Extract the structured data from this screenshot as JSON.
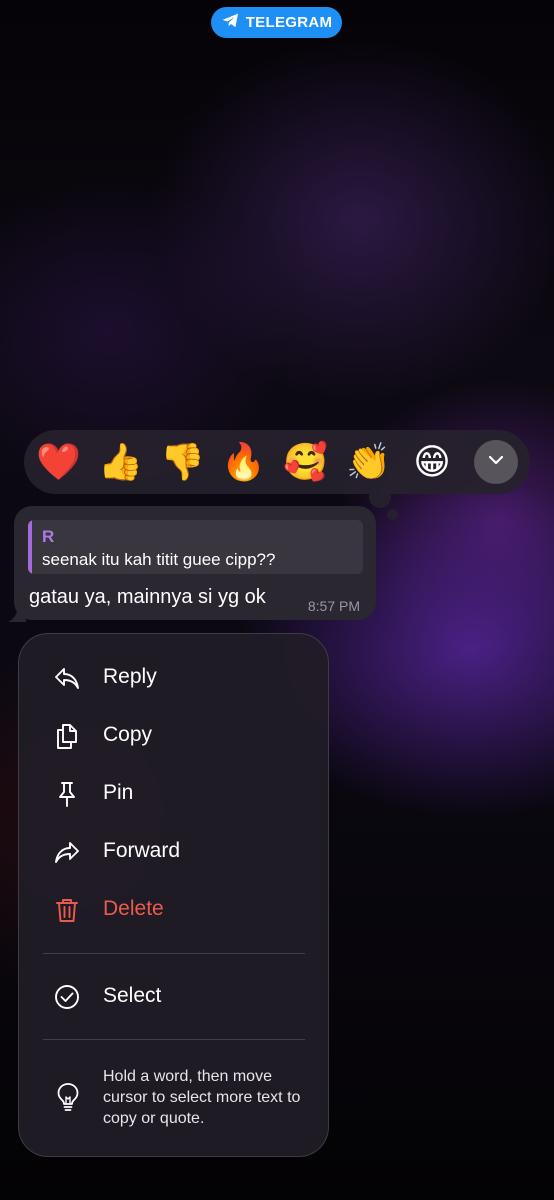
{
  "source_badge": {
    "label": "TELEGRAM",
    "color": "#1e8ff5"
  },
  "reactions": {
    "items": [
      {
        "name": "red-heart",
        "glyph": "❤️"
      },
      {
        "name": "thumbs-up",
        "glyph": "👍"
      },
      {
        "name": "thumbs-down",
        "glyph": "👎"
      },
      {
        "name": "fire",
        "glyph": "🔥"
      },
      {
        "name": "smiling-face-with-hearts",
        "glyph": "🥰"
      },
      {
        "name": "clapping-hands",
        "glyph": "👏"
      },
      {
        "name": "beaming-face",
        "glyph": "😁"
      }
    ],
    "expand_icon": "chevron-down-icon"
  },
  "message": {
    "reply": {
      "author": "R",
      "text": "seenak itu kah titit guee cipp??",
      "accent_color": "#a36bdc"
    },
    "text": "gatau ya, mainnya si yg ok",
    "time": "8:57 PM"
  },
  "menu": {
    "items": [
      {
        "label": "Reply",
        "icon": "reply-icon"
      },
      {
        "label": "Copy",
        "icon": "copy-icon"
      },
      {
        "label": "Pin",
        "icon": "pin-icon"
      },
      {
        "label": "Forward",
        "icon": "forward-icon"
      },
      {
        "label": "Delete",
        "icon": "trash-icon",
        "color": "#eb5a4e"
      }
    ],
    "select": {
      "label": "Select",
      "icon": "check-circle-icon"
    },
    "hint": {
      "text": "Hold a word, then move cursor to select more text to copy or quote.",
      "icon": "lightbulb-icon"
    }
  }
}
